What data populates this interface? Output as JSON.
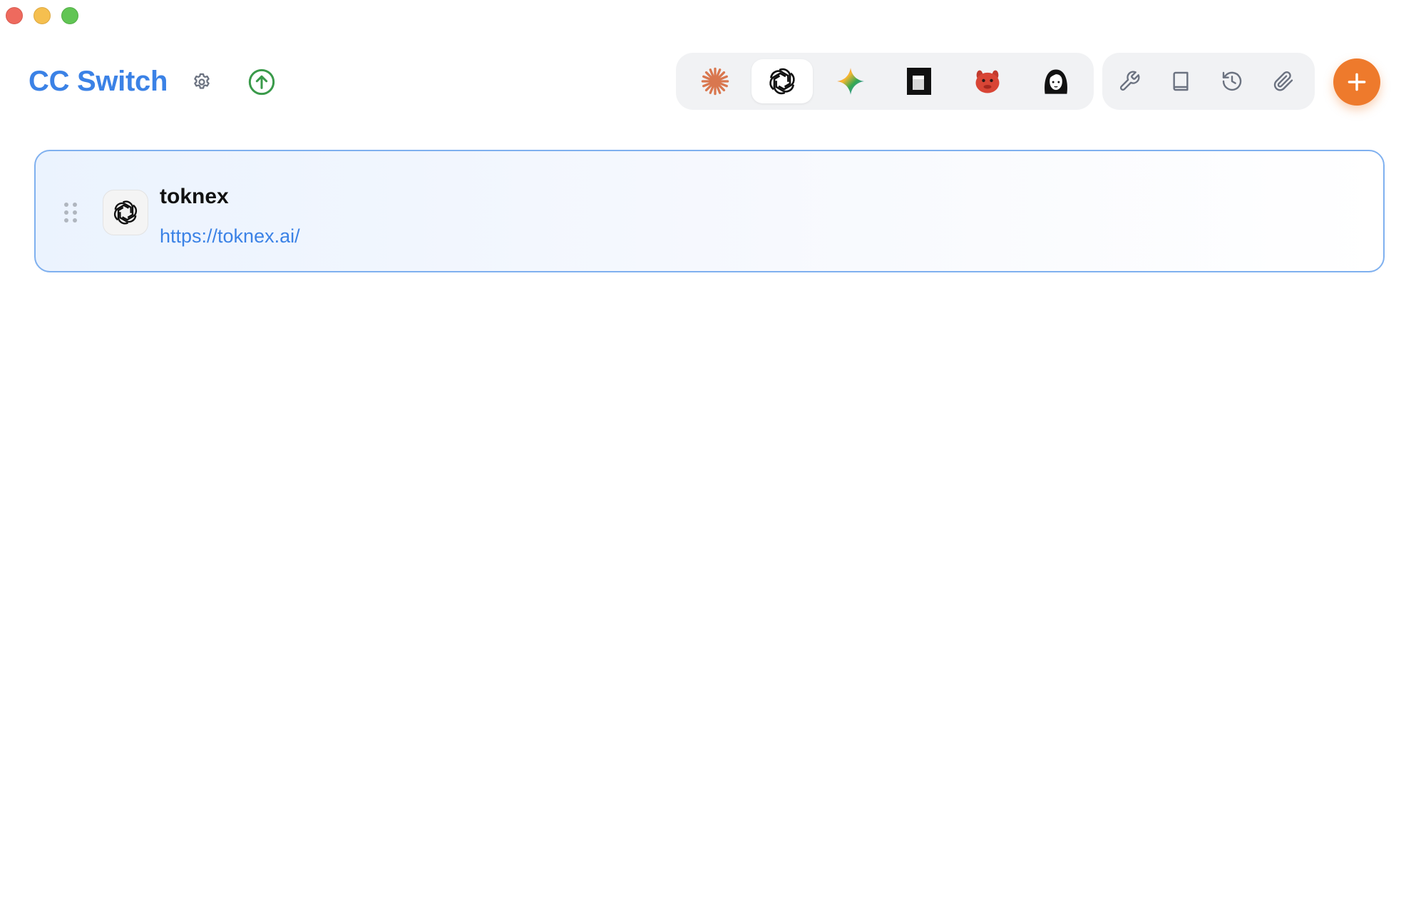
{
  "window": {
    "controls": [
      "close",
      "minimize",
      "maximize"
    ]
  },
  "header": {
    "title": "CC Switch",
    "settings_icon": "gear-icon",
    "update_icon": "arrow-up-circle-icon",
    "update_color": "#3a9a4a"
  },
  "app_tabs": [
    {
      "name": "claude",
      "icon": "claude-sparkle-icon",
      "active": false
    },
    {
      "name": "codex",
      "icon": "openai-logo-icon",
      "active": true
    },
    {
      "name": "gemini",
      "icon": "gemini-star-icon",
      "active": false
    },
    {
      "name": "terminal-app",
      "icon": "black-square-logo-icon",
      "active": false
    },
    {
      "name": "red-mascot-app",
      "icon": "red-mascot-icon",
      "active": false
    },
    {
      "name": "avatar-app",
      "icon": "avatar-face-icon",
      "active": false
    }
  ],
  "tools": [
    {
      "name": "tools",
      "icon": "wrench-icon"
    },
    {
      "name": "prompts",
      "icon": "book-icon"
    },
    {
      "name": "history",
      "icon": "history-icon"
    },
    {
      "name": "attachments",
      "icon": "paperclip-icon"
    }
  ],
  "add_button": {
    "icon": "plus-icon",
    "color": "#ee7a2c"
  },
  "providers": [
    {
      "name": "toknex",
      "url": "https://toknex.ai/",
      "icon": "openai-logo-icon",
      "selected": true
    }
  ],
  "colors": {
    "accent": "#3b82e6",
    "card_border": "#7fb0ef",
    "card_bg": "#ebf3fe",
    "tab_bg": "#f1f2f4"
  }
}
